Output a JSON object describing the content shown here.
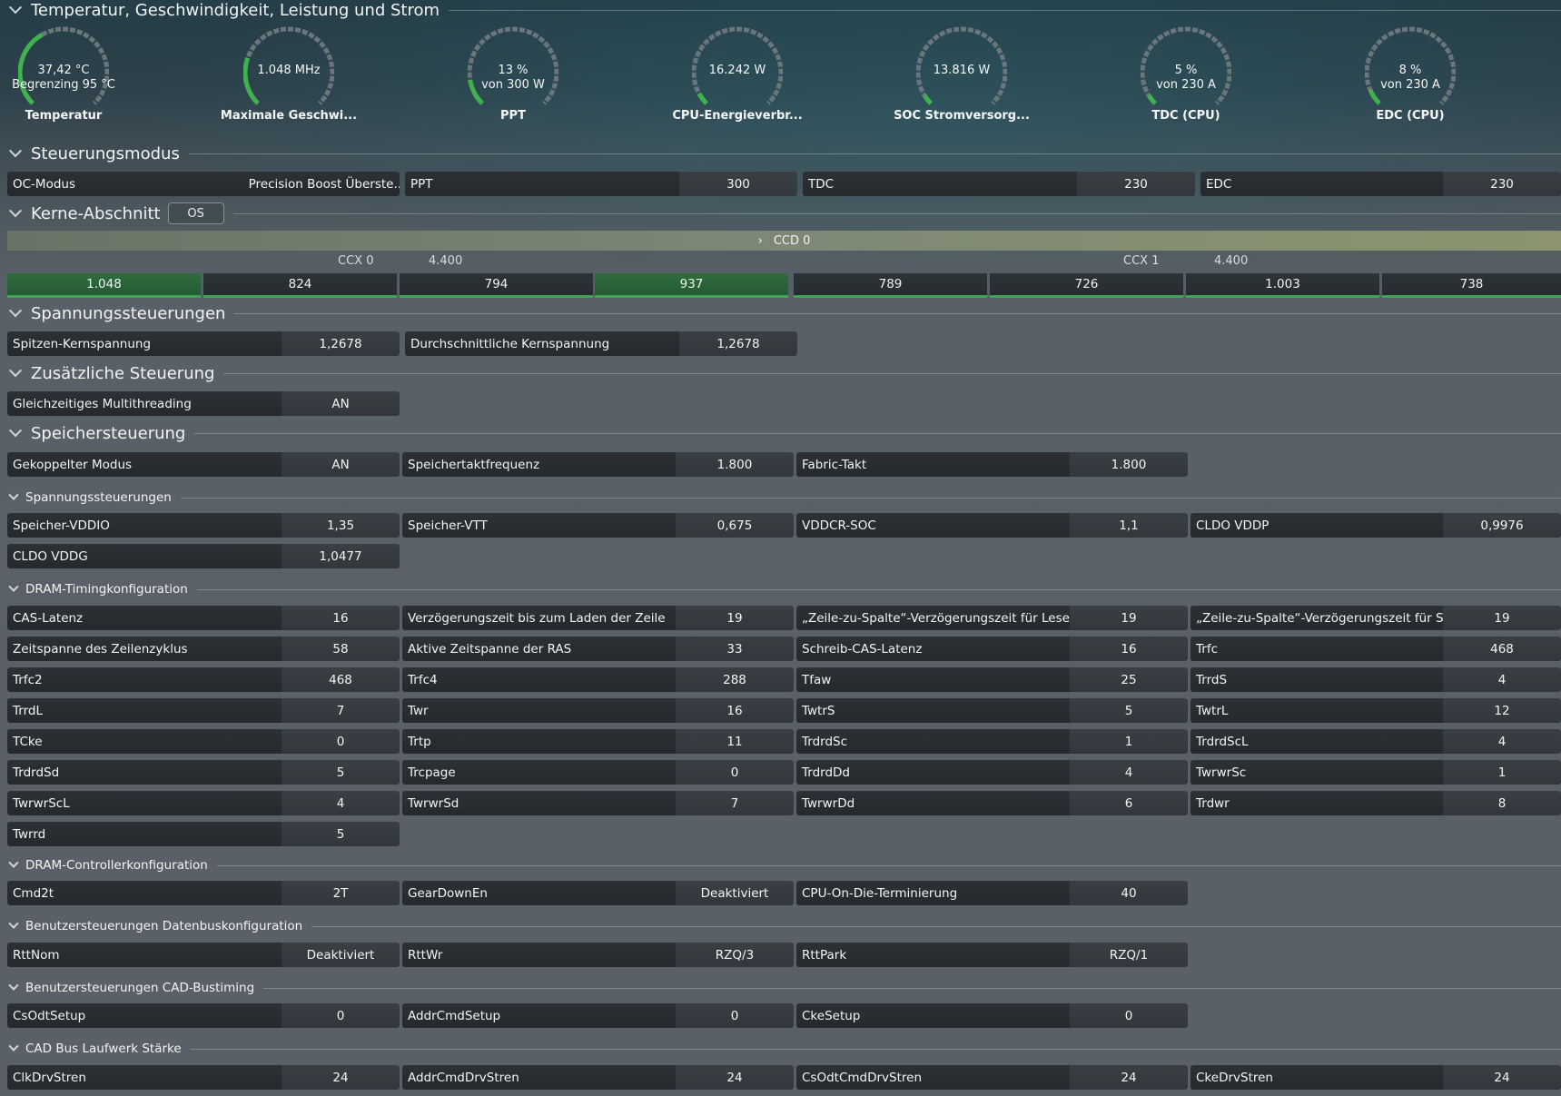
{
  "sections": {
    "temp": "Temperatur, Geschwindigkeit, Leistung und Strom",
    "control_mode": "Steuerungsmodus",
    "cores": "Kerne-Abschnitt",
    "voltage": "Spannungssteuerungen",
    "extra": "Zusätzliche Steuerung",
    "memory": "Speichersteuerung",
    "mem_voltage": "Spannungssteuerungen",
    "dram_timing": "DRAM-Timingkonfiguration",
    "dram_ctrl": "DRAM-Controllerkonfiguration",
    "databus": "Benutzersteuerungen Datenbuskonfiguration",
    "cad_bustiming": "Benutzersteuerungen CAD-Bustiming",
    "cad_drive": "CAD Bus Laufwerk Stärke"
  },
  "gauges": [
    {
      "line1": "37,42 °C",
      "line2": "Begrenzing 95 °C",
      "label": "Temperatur",
      "fill": 0.39
    },
    {
      "line1": "1.048  MHz",
      "line2": "",
      "label": "Maximale Geschwi...",
      "fill": 0.24
    },
    {
      "line1": "13 %",
      "line2": "von 300 W",
      "label": "PPT",
      "fill": 0.13
    },
    {
      "line1": "16.242 W",
      "line2": "",
      "label": "CPU-Energieverbr...",
      "fill": 0.06
    },
    {
      "line1": "13.816 W",
      "line2": "",
      "label": "SOC Stromversorg...",
      "fill": 0.05
    },
    {
      "line1": "5 %",
      "line2": "von 230 A",
      "label": "TDC (CPU)",
      "fill": 0.05
    },
    {
      "line1": "8 %",
      "line2": "von 230 A",
      "label": "EDC (CPU)",
      "fill": 0.08
    }
  ],
  "control_mode": {
    "oc_label": "OC-Modus",
    "oc_value": "Precision Boost Überste...",
    "ppt_label": "PPT",
    "ppt_value": "300",
    "tdc_label": "TDC",
    "tdc_value": "230",
    "edc_label": "EDC",
    "edc_value": "230"
  },
  "cores": {
    "os_badge": "OS",
    "ccd": "CCD 0",
    "ccx0": "CCX 0",
    "ccx0_freq": "4.400",
    "ccx1": "CCX 1",
    "ccx1_freq": "4.400",
    "values": [
      "1.048",
      "824",
      "794",
      "937",
      "789",
      "726",
      "1.003",
      "738"
    ]
  },
  "voltage": {
    "peak_label": "Spitzen-Kernspannung",
    "peak_value": "1,2678",
    "avg_label": "Durchschnittliche Kernspannung",
    "avg_value": "1,2678"
  },
  "extra": {
    "smt_label": "Gleichzeitiges Multithreading",
    "smt_value": "AN"
  },
  "memory": {
    "coupled_label": "Gekoppelter Modus",
    "coupled_value": "AN",
    "clock_label": "Speichertaktfrequenz",
    "clock_value": "1.800",
    "fabric_label": "Fabric-Takt",
    "fabric_value": "1.800"
  },
  "mem_voltage": [
    [
      "Speicher-VDDIO",
      "1,35"
    ],
    [
      "Speicher-VTT",
      "0,675"
    ],
    [
      "VDDCR-SOC",
      "1,1"
    ],
    [
      "CLDO VDDP",
      "0,9976"
    ],
    [
      "CLDO VDDG",
      "1,0477"
    ]
  ],
  "dram_timing": [
    [
      "CAS-Latenz",
      "16"
    ],
    [
      "Verzögerungszeit bis zum Laden der Zeile",
      "19"
    ],
    [
      "„Zeile-zu-Spalte“-Verzögerungszeit für Lesevo...",
      "19"
    ],
    [
      "„Zeile-zu-Spalte“-Verzögerungszeit für Schrei...",
      "19"
    ],
    [
      "Zeitspanne des Zeilenzyklus",
      "58"
    ],
    [
      "Aktive Zeitspanne der RAS",
      "33"
    ],
    [
      "Schreib-CAS-Latenz",
      "16"
    ],
    [
      "Trfc",
      "468"
    ],
    [
      "Trfc2",
      "468"
    ],
    [
      "Trfc4",
      "288"
    ],
    [
      "Tfaw",
      "25"
    ],
    [
      "TrrdS",
      "4"
    ],
    [
      "TrrdL",
      "7"
    ],
    [
      "Twr",
      "16"
    ],
    [
      "TwtrS",
      "5"
    ],
    [
      "TwtrL",
      "12"
    ],
    [
      "TCke",
      "0"
    ],
    [
      "Trtp",
      "11"
    ],
    [
      "TrdrdSc",
      "1"
    ],
    [
      "TrdrdScL",
      "4"
    ],
    [
      "TrdrdSd",
      "5"
    ],
    [
      "Trcpage",
      "0"
    ],
    [
      "TrdrdDd",
      "4"
    ],
    [
      "TwrwrSc",
      "1"
    ],
    [
      "TwrwrScL",
      "4"
    ],
    [
      "TwrwrSd",
      "7"
    ],
    [
      "TwrwrDd",
      "6"
    ],
    [
      "Trdwr",
      "8"
    ],
    [
      "Twrrd",
      "5"
    ]
  ],
  "dram_ctrl": [
    [
      "Cmd2t",
      "2T"
    ],
    [
      "GearDownEn",
      "Deaktiviert"
    ],
    [
      "CPU-On-Die-Terminierung",
      "40"
    ]
  ],
  "databus": [
    [
      "RttNom",
      "Deaktiviert"
    ],
    [
      "RttWr",
      "RZQ/3"
    ],
    [
      "RttPark",
      "RZQ/1"
    ]
  ],
  "cad_bustiming": [
    [
      "CsOdtSetup",
      "0"
    ],
    [
      "AddrCmdSetup",
      "0"
    ],
    [
      "CkeSetup",
      "0"
    ]
  ],
  "cad_drive": [
    [
      "ClkDrvStren",
      "24"
    ],
    [
      "AddrCmdDrvStren",
      "24"
    ],
    [
      "CsOdtCmdDrvStren",
      "24"
    ],
    [
      "CkeDrvStren",
      "24"
    ]
  ],
  "colors": {
    "accent": "#3fa452",
    "field_label_bg": "#282c30",
    "field_value_bg": "#363a3f"
  }
}
